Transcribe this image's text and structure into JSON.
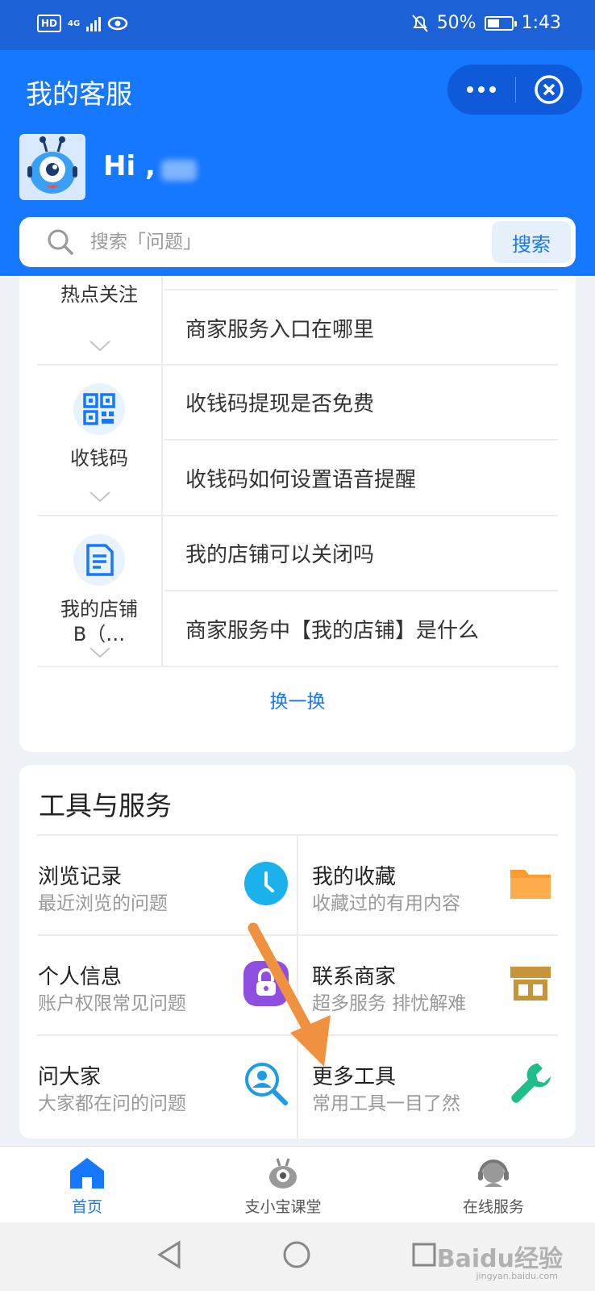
{
  "status_bar": {
    "hd": "HD",
    "network": "4G",
    "battery_percent": "50%",
    "battery_level": 0.5,
    "time": "1:43"
  },
  "header": {
    "title": "我的客服",
    "greeting": "Hi ,",
    "search_placeholder": "搜索「问题」",
    "search_button": "搜索"
  },
  "hot_section": {
    "categories": [
      {
        "label": "热点关注",
        "icon": "fire-icon",
        "questions": [
          "商家服务入口在哪里"
        ]
      },
      {
        "label": "收钱码",
        "icon": "qr-code-icon",
        "questions": [
          "收钱码提现是否免费",
          "收钱码如何设置语音提醒"
        ]
      },
      {
        "label": "我的店铺B（…",
        "icon": "document-icon",
        "questions": [
          "我的店铺可以关闭吗",
          "商家服务中【我的店铺】是什么"
        ]
      }
    ],
    "swap_label": "换一换"
  },
  "tools": {
    "title": "工具与服务",
    "items": [
      {
        "title": "浏览记录",
        "subtitle": "最近浏览的问题",
        "icon": "clock-icon",
        "color": "#1bb1ea"
      },
      {
        "title": "我的收藏",
        "subtitle": "收藏过的有用内容",
        "icon": "folder-icon",
        "color": "#ff9a2e"
      },
      {
        "title": "个人信息",
        "subtitle": "账户权限常见问题",
        "icon": "lock-icon",
        "color": "#8e4fe0"
      },
      {
        "title": "联系商家",
        "subtitle": "超多服务 排忧解难",
        "icon": "store-icon",
        "color": "#c6953a"
      },
      {
        "title": "问大家",
        "subtitle": "大家都在问的问题",
        "icon": "search-person-icon",
        "color": "#1b9be8"
      },
      {
        "title": "更多工具",
        "subtitle": "常用工具一目了然",
        "icon": "wrench-icon",
        "color": "#1fbd8a"
      }
    ]
  },
  "tabbar": {
    "tabs": [
      {
        "label": "首页",
        "icon": "home-icon",
        "active": true
      },
      {
        "label": "支小宝课堂",
        "icon": "mascot-icon",
        "active": false
      },
      {
        "label": "在线服务",
        "icon": "headset-icon",
        "active": false
      }
    ]
  },
  "watermark": {
    "text": "Baidu经验",
    "url_text": "jingyan.baidu.com"
  },
  "colors": {
    "brand": "#1677ff",
    "status_bar": "#1c61d6",
    "arrow": "#f0913f"
  }
}
